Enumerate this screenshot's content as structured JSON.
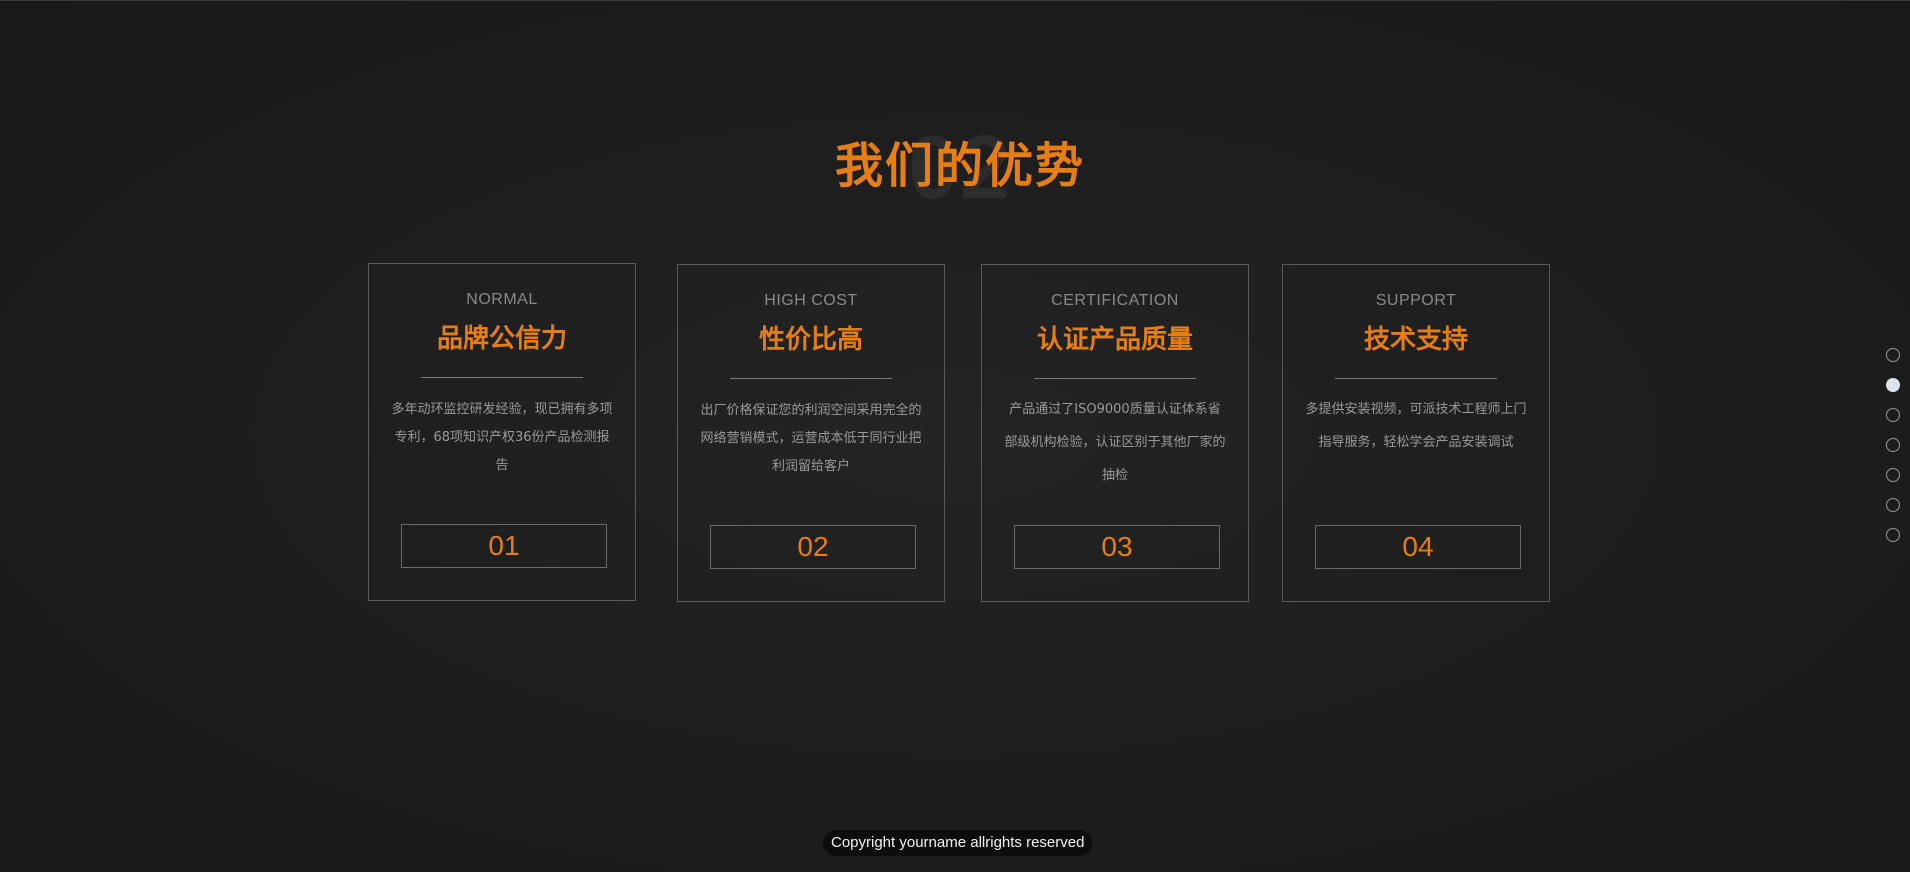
{
  "section": {
    "number": "02",
    "title": "我们的优势"
  },
  "cards": [
    {
      "en": "NORMAL",
      "title": "品牌公信力",
      "desc": "多年动环监控研发经验，现已拥有多项专利，68项知识产权36份产品检测报告",
      "number": "01"
    },
    {
      "en": "HIGH COST",
      "title": "性价比高",
      "desc": "出厂价格保证您的利润空间采用完全的网络营销模式，运营成本低于同行业把利润留给客户",
      "number": "02"
    },
    {
      "en": "CERTIFICATION",
      "title": "认证产品质量",
      "desc": "产品通过了ISO9000质量认证体系省部级机构检验，认证区别于其他厂家的抽检",
      "number": "03"
    },
    {
      "en": "SUPPORT",
      "title": "技术支持",
      "desc": "多提供安装视频，可派技术工程师上门指导服务，轻松学会产品安装调试",
      "number": "04"
    }
  ],
  "pager": {
    "total": 7,
    "active_index": 1
  },
  "footer": {
    "copyright": "Copyright yourname allrights reserved"
  },
  "colors": {
    "accent": "#e67e14",
    "background": "#1e1e1e",
    "pager_active": "#dde3ea"
  }
}
